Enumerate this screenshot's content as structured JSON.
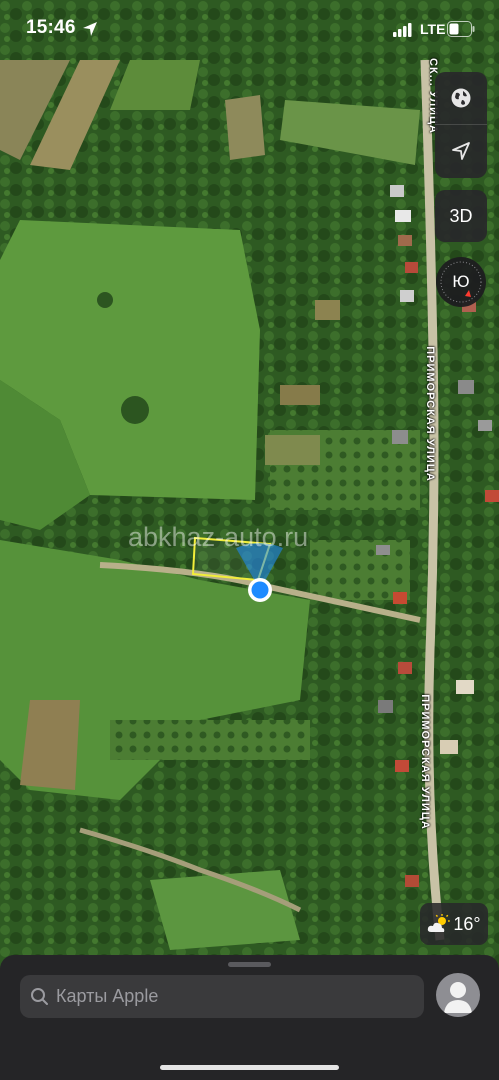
{
  "status_bar": {
    "time": "15:46",
    "network": "LTE"
  },
  "map": {
    "road_labels": {
      "top_partial": "СК... УЛИЦА",
      "primary_1": "ПРИМОРСКАЯ УЛИЦА",
      "primary_2": "ПРИМОРСКАЯ УЛИЦА"
    },
    "watermark": "abkhaz-auto.ru",
    "parcel_outline_color": "#f2ee3a",
    "location_dot_color": "#1e8bff"
  },
  "controls": {
    "map_mode_icon": "globe-icon",
    "locate_icon": "location-arrow-icon",
    "three_d_label": "3D",
    "compass_label": "Ю"
  },
  "weather": {
    "icon": "cloud-sun-icon",
    "temperature": "16°"
  },
  "bottom_sheet": {
    "search_placeholder": "Карты Apple",
    "avatar_icon": "person-icon"
  }
}
